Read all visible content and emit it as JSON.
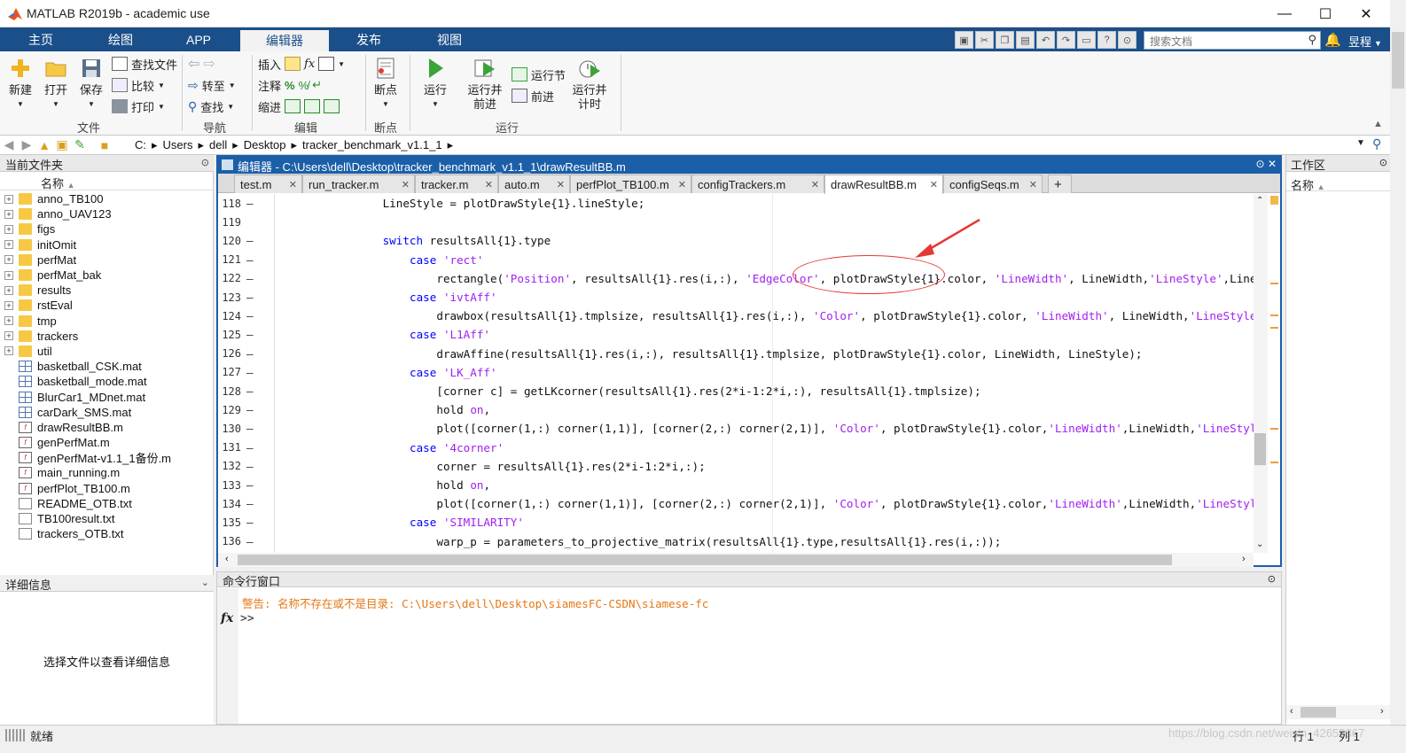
{
  "window": {
    "title": "MATLAB R2019b - academic use",
    "minimize": "—",
    "maximize": "☐",
    "close": "✕"
  },
  "ribbon_tabs": [
    "主页",
    "绘图",
    "APP",
    "编辑器",
    "发布",
    "视图"
  ],
  "search": {
    "placeholder": "搜索文档"
  },
  "user": {
    "name": "昱程"
  },
  "ribbon": {
    "file": {
      "new": "新建",
      "open": "打开",
      "save": "保存",
      "find_files": "查找文件",
      "compare": "比较",
      "print": "打印",
      "group": "文件"
    },
    "navigate": {
      "goto": "转至",
      "find": "查找",
      "group": "导航"
    },
    "edit": {
      "insert": "插入",
      "comment": "注释",
      "indent": "缩进",
      "fx": "fx",
      "group": "编辑"
    },
    "breakpoints": {
      "label": "断点",
      "group": "断点"
    },
    "run": {
      "run": "运行",
      "run_advance_1": "运行并",
      "run_advance_2": "前进",
      "run_section": "运行节",
      "advance": "前进",
      "run_time_1": "运行并",
      "run_time_2": "计时",
      "group": "运行"
    }
  },
  "address": {
    "path": [
      "C:",
      "Users",
      "dell",
      "Desktop",
      "tracker_benchmark_v1.1_1"
    ]
  },
  "current_folder": {
    "title": "当前文件夹",
    "name_header": "名称",
    "items": [
      {
        "name": "anno_TB100",
        "kind": "folder"
      },
      {
        "name": "anno_UAV123",
        "kind": "folder"
      },
      {
        "name": "figs",
        "kind": "folder"
      },
      {
        "name": "initOmit",
        "kind": "folder"
      },
      {
        "name": "perfMat",
        "kind": "folder"
      },
      {
        "name": "perfMat_bak",
        "kind": "folder"
      },
      {
        "name": "results",
        "kind": "folder"
      },
      {
        "name": "rstEval",
        "kind": "folder"
      },
      {
        "name": "tmp",
        "kind": "folder"
      },
      {
        "name": "trackers",
        "kind": "folder"
      },
      {
        "name": "util",
        "kind": "folder"
      },
      {
        "name": "basketball_CSK.mat",
        "kind": "mat"
      },
      {
        "name": "basketball_mode.mat",
        "kind": "mat"
      },
      {
        "name": "BlurCar1_MDnet.mat",
        "kind": "mat"
      },
      {
        "name": "carDark_SMS.mat",
        "kind": "mat"
      },
      {
        "name": "drawResultBB.m",
        "kind": "m"
      },
      {
        "name": "genPerfMat.m",
        "kind": "m"
      },
      {
        "name": "genPerfMat-v1.1_1备份.m",
        "kind": "m"
      },
      {
        "name": "main_running.m",
        "kind": "m"
      },
      {
        "name": "perfPlot_TB100.m",
        "kind": "m"
      },
      {
        "name": "README_OTB.txt",
        "kind": "txt"
      },
      {
        "name": "TB100result.txt",
        "kind": "txt"
      },
      {
        "name": "trackers_OTB.txt",
        "kind": "txt"
      }
    ]
  },
  "details": {
    "title": "详细信息",
    "message": "选择文件以查看详细信息"
  },
  "editor": {
    "title": "编辑器 - C:\\Users\\dell\\Desktop\\tracker_benchmark_v1.1_1\\drawResultBB.m",
    "tabs": [
      "test.m",
      "run_tracker.m",
      "tracker.m",
      "auto.m",
      "perfPlot_TB100.m",
      "configTrackers.m",
      "drawResultBB.m",
      "configSeqs.m"
    ],
    "active_tab": "drawResultBB.m",
    "add_tab": "+",
    "lines": [
      {
        "n": "118",
        "dash": true,
        "indent": 16,
        "segs": [
          [
            "t",
            "LineStyle = plotDrawStyle{1}.lineStyle;"
          ]
        ]
      },
      {
        "n": "119",
        "dash": false,
        "indent": 0,
        "segs": []
      },
      {
        "n": "120",
        "dash": true,
        "indent": 16,
        "segs": [
          [
            "k",
            "switch"
          ],
          [
            "t",
            " resultsAll{1}.type"
          ]
        ]
      },
      {
        "n": "121",
        "dash": true,
        "indent": 20,
        "segs": [
          [
            "k",
            "case"
          ],
          [
            "t",
            " "
          ],
          [
            "s",
            "'rect'"
          ]
        ]
      },
      {
        "n": "122",
        "dash": true,
        "indent": 24,
        "segs": [
          [
            "t",
            "rectangle("
          ],
          [
            "s",
            "'Position'"
          ],
          [
            "t",
            ", resultsAll{1}.res(i,:), "
          ],
          [
            "s",
            "'EdgeColor'"
          ],
          [
            "t",
            ", plotDrawStyle{1}.color, "
          ],
          [
            "s",
            "'LineWidth'"
          ],
          [
            "t",
            ", LineWidth,"
          ],
          [
            "s",
            "'LineStyle'"
          ],
          [
            "t",
            ",LineStyle);"
          ]
        ]
      },
      {
        "n": "123",
        "dash": true,
        "indent": 20,
        "segs": [
          [
            "k",
            "case"
          ],
          [
            "t",
            " "
          ],
          [
            "s",
            "'ivtAff'"
          ]
        ]
      },
      {
        "n": "124",
        "dash": true,
        "indent": 24,
        "segs": [
          [
            "t",
            "drawbox(resultsAll{1}.tmplsize, resultsAll{1}.res(i,:), "
          ],
          [
            "s",
            "'Color'"
          ],
          [
            "t",
            ", plotDrawStyle{1}.color, "
          ],
          [
            "s",
            "'LineWidth'"
          ],
          [
            "t",
            ", LineWidth,"
          ],
          [
            "s",
            "'LineStyle'"
          ],
          [
            "t",
            ",LineStyle);"
          ]
        ]
      },
      {
        "n": "125",
        "dash": true,
        "indent": 20,
        "segs": [
          [
            "k",
            "case"
          ],
          [
            "t",
            " "
          ],
          [
            "s",
            "'L1Aff'"
          ]
        ]
      },
      {
        "n": "126",
        "dash": true,
        "indent": 24,
        "segs": [
          [
            "t",
            "drawAffine(resultsAll{1}.res(i,:), resultsAll{1}.tmplsize, plotDrawStyle{1}.color, LineWidth, LineStyle);"
          ]
        ]
      },
      {
        "n": "127",
        "dash": true,
        "indent": 20,
        "segs": [
          [
            "k",
            "case"
          ],
          [
            "t",
            " "
          ],
          [
            "s",
            "'LK_Aff'"
          ]
        ]
      },
      {
        "n": "128",
        "dash": true,
        "indent": 24,
        "segs": [
          [
            "t",
            "[corner c] = getLKcorner(resultsAll{1}.res(2*i-1:2*i,:), resultsAll{1}.tmplsize);"
          ]
        ]
      },
      {
        "n": "129",
        "dash": true,
        "indent": 24,
        "segs": [
          [
            "t",
            "hold "
          ],
          [
            "s",
            "on"
          ],
          [
            "t",
            ","
          ]
        ]
      },
      {
        "n": "130",
        "dash": true,
        "indent": 24,
        "segs": [
          [
            "t",
            "plot([corner(1,:) corner(1,1)], [corner(2,:) corner(2,1)], "
          ],
          [
            "s",
            "'Color'"
          ],
          [
            "t",
            ", plotDrawStyle{1}.color,"
          ],
          [
            "s",
            "'LineWidth'"
          ],
          [
            "t",
            ",LineWidth,"
          ],
          [
            "s",
            "'LineStyle'"
          ],
          [
            "t",
            ",LineStyle);"
          ]
        ]
      },
      {
        "n": "131",
        "dash": true,
        "indent": 20,
        "segs": [
          [
            "k",
            "case"
          ],
          [
            "t",
            " "
          ],
          [
            "s",
            "'4corner'"
          ]
        ]
      },
      {
        "n": "132",
        "dash": true,
        "indent": 24,
        "segs": [
          [
            "t",
            "corner = resultsAll{1}.res(2*i-1:2*i,:);"
          ]
        ]
      },
      {
        "n": "133",
        "dash": true,
        "indent": 24,
        "segs": [
          [
            "t",
            "hold "
          ],
          [
            "s",
            "on"
          ],
          [
            "t",
            ","
          ]
        ]
      },
      {
        "n": "134",
        "dash": true,
        "indent": 24,
        "segs": [
          [
            "t",
            "plot([corner(1,:) corner(1,1)], [corner(2,:) corner(2,1)], "
          ],
          [
            "s",
            "'Color'"
          ],
          [
            "t",
            ", plotDrawStyle{1}.color,"
          ],
          [
            "s",
            "'LineWidth'"
          ],
          [
            "t",
            ",LineWidth,"
          ],
          [
            "s",
            "'LineStyle'"
          ],
          [
            "t",
            ",LineStyle);"
          ]
        ]
      },
      {
        "n": "135",
        "dash": true,
        "indent": 20,
        "segs": [
          [
            "k",
            "case"
          ],
          [
            "t",
            " "
          ],
          [
            "s",
            "'SIMILARITY'"
          ]
        ]
      },
      {
        "n": "136",
        "dash": true,
        "indent": 24,
        "segs": [
          [
            "t",
            "warp_p = parameters_to_projective_matrix(resultsAll{1}.type,resultsAll{1}.res(i,:));"
          ]
        ]
      }
    ]
  },
  "command_window": {
    "title": "命令行窗口",
    "warning": "警告: 名称不存在或不是目录: C:\\Users\\dell\\Desktop\\siamesFC-CSDN\\siamese-fc",
    "prompt": ">>",
    "fx": "fx"
  },
  "workspace": {
    "title": "工作区",
    "name_header": "名称"
  },
  "status": {
    "text": "就绪",
    "row_label": "行",
    "row": "1",
    "col_label": "列",
    "col": "1",
    "watermark": "https://blog.csdn.net/weixin_42658867"
  },
  "colors": {
    "accent": "#1b4f8a",
    "keyword": "#0000ff",
    "string": "#a020f0",
    "warning": "#e57716",
    "annotation": "#e53935"
  }
}
